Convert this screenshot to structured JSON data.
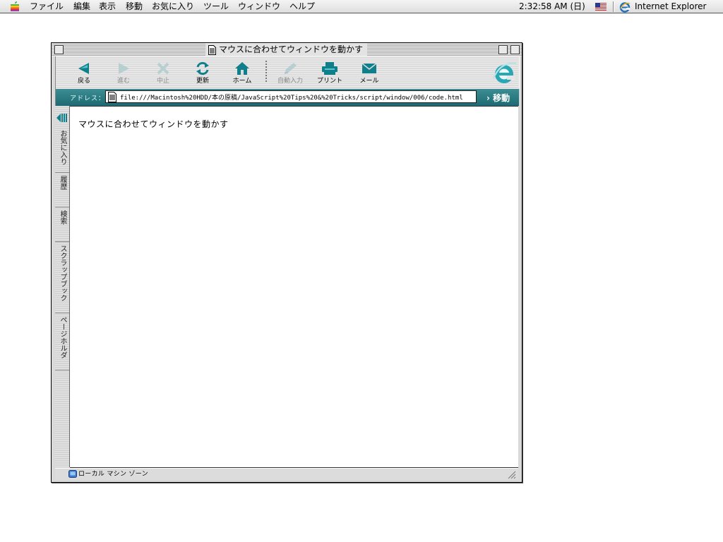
{
  "menubar": {
    "items": [
      "ファイル",
      "編集",
      "表示",
      "移動",
      "お気に入り",
      "ツール",
      "ウィンドウ",
      "ヘルプ"
    ],
    "clock": "2:32:58 AM (日)",
    "app_name": "Internet Explorer",
    "icons": {
      "apple": "apple-menu-icon",
      "flag": "us-flag-icon",
      "app": "ie-icon"
    }
  },
  "window": {
    "title": "マウスに合わせてウィンドウを動かす"
  },
  "toolbar": {
    "buttons": [
      {
        "label": "戻る",
        "icon": "back-arrow-icon",
        "enabled": true
      },
      {
        "label": "進む",
        "icon": "forward-arrow-icon",
        "enabled": false
      },
      {
        "label": "中止",
        "icon": "stop-icon",
        "enabled": false
      },
      {
        "label": "更新",
        "icon": "refresh-icon",
        "enabled": true
      },
      {
        "label": "ホーム",
        "icon": "home-icon",
        "enabled": true
      },
      {
        "label": "自動入力",
        "icon": "autofill-icon",
        "enabled": false
      },
      {
        "label": "プリント",
        "icon": "print-icon",
        "enabled": true
      },
      {
        "label": "メール",
        "icon": "mail-icon",
        "enabled": true
      }
    ]
  },
  "address": {
    "label": "アドレス：",
    "value": "file:///Macintosh%20HDD/本の原稿/JavaScript%20Tips%20&%20Tricks/script/window/006/code.html",
    "go_label": "移動"
  },
  "sidebar": {
    "tabs": [
      "お気に入り",
      "履歴",
      "検索",
      "スクラップブック",
      "ページホルダ"
    ]
  },
  "page": {
    "body_text": "マウスに合わせてウィンドウを動かす"
  },
  "status": {
    "text": "ローカル マシン ゾーン"
  },
  "colors": {
    "accent": "#1e6a72",
    "icon_teal": "#0f7f8c",
    "disabled": "#8a8a8a"
  }
}
